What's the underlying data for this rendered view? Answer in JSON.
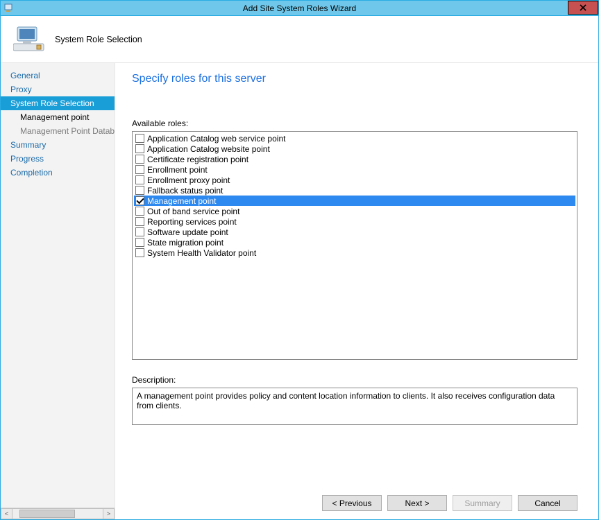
{
  "window": {
    "title": "Add Site System Roles Wizard",
    "close_label": "✕"
  },
  "header": {
    "title": "System Role Selection"
  },
  "sidebar": {
    "items": [
      {
        "label": "General",
        "selected": false,
        "indent": 0
      },
      {
        "label": "Proxy",
        "selected": false,
        "indent": 0
      },
      {
        "label": "System Role Selection",
        "selected": true,
        "indent": 0
      },
      {
        "label": "Management point",
        "selected": false,
        "indent": 1,
        "bold": true
      },
      {
        "label": "Management Point Database",
        "selected": false,
        "indent": 1,
        "dim": true
      },
      {
        "label": "Summary",
        "selected": false,
        "indent": 0
      },
      {
        "label": "Progress",
        "selected": false,
        "indent": 0
      },
      {
        "label": "Completion",
        "selected": false,
        "indent": 0
      }
    ],
    "scroll_left": "<",
    "scroll_right": ">"
  },
  "main": {
    "heading": "Specify roles for this server",
    "available_label": "Available roles:",
    "roles": [
      {
        "label": "Application Catalog web service point",
        "checked": false,
        "selected": false
      },
      {
        "label": "Application Catalog website point",
        "checked": false,
        "selected": false
      },
      {
        "label": "Certificate registration point",
        "checked": false,
        "selected": false
      },
      {
        "label": "Enrollment point",
        "checked": false,
        "selected": false
      },
      {
        "label": "Enrollment proxy point",
        "checked": false,
        "selected": false
      },
      {
        "label": "Fallback status point",
        "checked": false,
        "selected": false
      },
      {
        "label": "Management point",
        "checked": true,
        "selected": true
      },
      {
        "label": "Out of band service point",
        "checked": false,
        "selected": false
      },
      {
        "label": "Reporting services point",
        "checked": false,
        "selected": false
      },
      {
        "label": "Software update point",
        "checked": false,
        "selected": false
      },
      {
        "label": "State migration point",
        "checked": false,
        "selected": false
      },
      {
        "label": "System Health Validator point",
        "checked": false,
        "selected": false
      }
    ],
    "description_label": "Description:",
    "description_text": "A management point provides policy and content location information to clients.  It also receives configuration data from clients."
  },
  "footer": {
    "previous": "< Previous",
    "next": "Next >",
    "summary": "Summary",
    "cancel": "Cancel"
  }
}
